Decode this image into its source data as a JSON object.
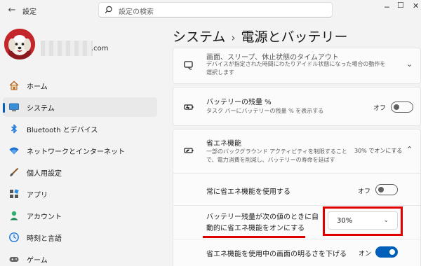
{
  "app": {
    "title": "設定",
    "search_placeholder": "設定の検索"
  },
  "account": {
    "email_domain": ".com"
  },
  "sidebar": {
    "items": [
      {
        "label": "ホーム",
        "icon": "home-icon"
      },
      {
        "label": "システム",
        "icon": "monitor-icon",
        "active": true
      },
      {
        "label": "Bluetooth とデバイス",
        "icon": "bluetooth-icon"
      },
      {
        "label": "ネットワークとインターネット",
        "icon": "wifi-icon"
      },
      {
        "label": "個人用設定",
        "icon": "brush-icon"
      },
      {
        "label": "アプリ",
        "icon": "apps-icon"
      },
      {
        "label": "アカウント",
        "icon": "person-icon"
      },
      {
        "label": "時刻と言語",
        "icon": "clock-globe-icon"
      },
      {
        "label": "ゲーム",
        "icon": "gamepad-icon"
      }
    ]
  },
  "page": {
    "breadcrumb_parent": "システム",
    "breadcrumb_separator": "›",
    "title": "電源とバッテリー"
  },
  "cards": {
    "sleep": {
      "title": "画面、スリープ、休止状態のタイムアウト",
      "desc": "デバイスが指定された時間にわたりアイドル状態になった場合の動作を選択します"
    },
    "battery_pct": {
      "title": "バッテリーの残量 %",
      "desc": "タスク バーにバッテリーの残量 % を表示する",
      "state": "オフ",
      "on": false
    },
    "saver": {
      "title": "省エネ機能",
      "desc_line1": "一部のバックグラウンド アクティビティを制限すること",
      "desc_line2": "で、電力消費を削減し、バッテリーの寿命を延ばす",
      "status": "30% でオンにする"
    },
    "always_on": {
      "label": "常に省エネ機能を使用する",
      "state": "オフ",
      "on": false
    },
    "auto_threshold": {
      "label_line1": "バッテリー残量が次の値のときに自",
      "label_line2": "動的に省エネ機能をオンにする",
      "selected": "30%"
    },
    "dim_screen": {
      "label": "省エネ機能を使用中の画面の明るさを下げる",
      "state": "オン",
      "on": true
    }
  },
  "colors": {
    "accent": "#005fb8",
    "highlight": "#e00000"
  }
}
